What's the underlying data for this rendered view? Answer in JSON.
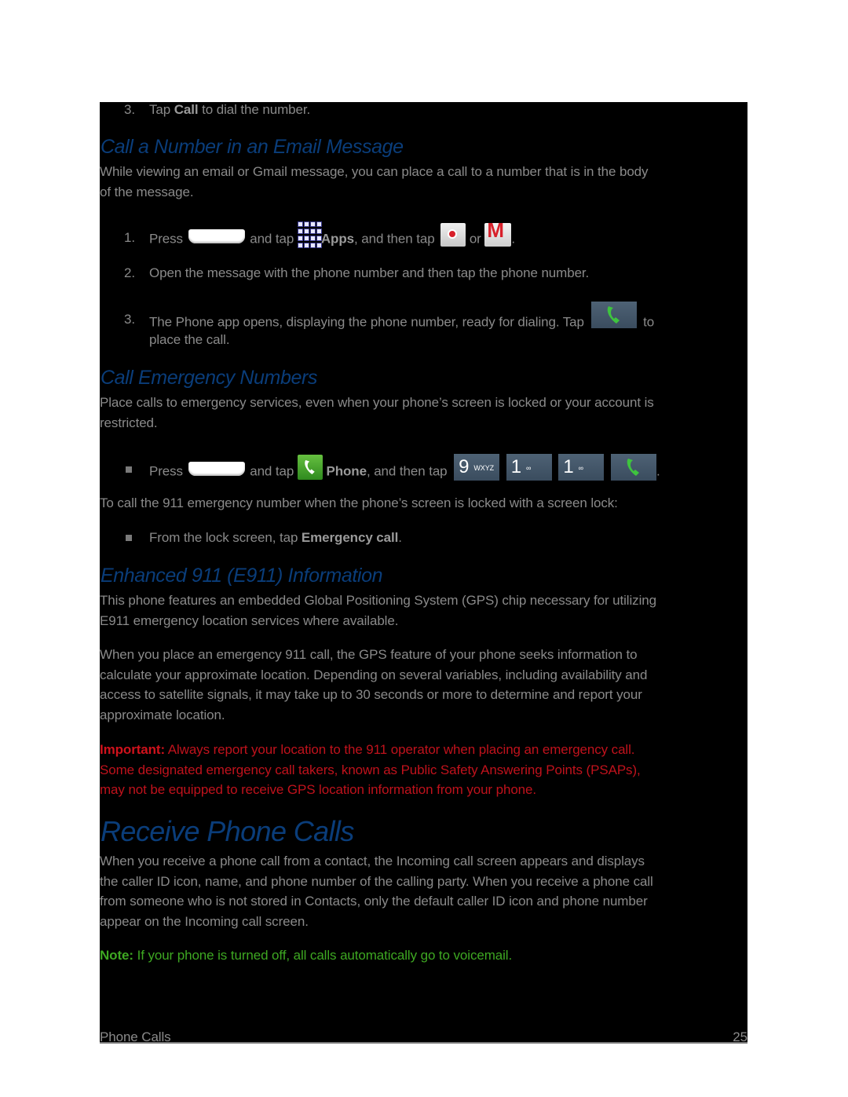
{
  "top_step": {
    "number": "3.",
    "prefix": "Tap ",
    "bold": "Call",
    "suffix": " to dial the number."
  },
  "section_email": {
    "heading": "Call a Number in an Email Message",
    "intro_line1": "While viewing an email or Gmail message, you can place a call to a number that is in the body",
    "intro_line2": "of the message.",
    "steps": [
      {
        "number": "1.",
        "press": "Press",
        "and_tap": "and tap",
        "apps_bold": "Apps",
        "then_tap": ", and then tap",
        "or": "or",
        "end": "."
      },
      {
        "number": "2.",
        "text": "Open the message with the phone number and then tap the phone number."
      },
      {
        "number": "3.",
        "text_line1": "The Phone app opens, displaying the phone number, ready for dialing. Tap",
        "to": "to",
        "text_line2": "place the call."
      }
    ]
  },
  "section_emergency": {
    "heading": "Call Emergency Numbers",
    "intro_line1": "Place calls to emergency services, even when your phone’s screen is locked or your account is",
    "intro_line2": "restricted.",
    "bullet1": {
      "press": "Press",
      "and_tap": "and tap",
      "phone_bold": "Phone",
      "then_tap": ", and then tap",
      "end": "."
    },
    "keys": [
      {
        "digit": "9",
        "letters": "WXYZ"
      },
      {
        "digit": "1",
        "letters": "∞"
      },
      {
        "digit": "1",
        "letters": "∞"
      }
    ],
    "lock_intro": "To call the 911 emergency number when the phone’s screen is locked with a screen lock:",
    "bullet2": {
      "prefix": "From the lock screen, tap ",
      "bold": "Emergency call",
      "suffix": "."
    }
  },
  "section_e911": {
    "heading": "Enhanced 911 (E911) Information",
    "p1_line1": "This phone features an embedded Global Positioning System (GPS) chip necessary for utilizing",
    "p1_line2": "E911 emergency location services where available.",
    "p2_lines": [
      "When you place an emergency 911 call, the GPS feature of your phone seeks information to",
      "calculate your approximate location. Depending on several variables, including availability and",
      "access to satellite signals, it may take up to 30 seconds or more to determine and report your",
      "approximate location."
    ],
    "important_label": "Important:",
    "important_lines": [
      " Always report your location to the 911 operator when placing an emergency call.",
      "Some designated emergency call takers, known as Public Safety Answering Points (PSAPs),",
      "may not be equipped to receive GPS location information from your phone."
    ]
  },
  "section_receive": {
    "heading": "Receive Phone Calls",
    "p_lines": [
      "When you receive a phone call from a contact, the Incoming call screen appears and displays",
      "the caller ID icon, name, and phone number of the calling party. When you receive a phone call",
      "from someone who is not stored in Contacts, only the default caller ID icon and phone number",
      "appear on the Incoming call screen."
    ],
    "note_label": "Note:",
    "note_text": " If your phone is turned off, all calls automatically go to voicemail."
  },
  "footer": {
    "section": "Phone Calls",
    "page": "25"
  },
  "colors": {
    "heading": "#0a3d7a",
    "important": "#c0121c",
    "note": "#3ea822",
    "body": "#8a8a8a"
  }
}
